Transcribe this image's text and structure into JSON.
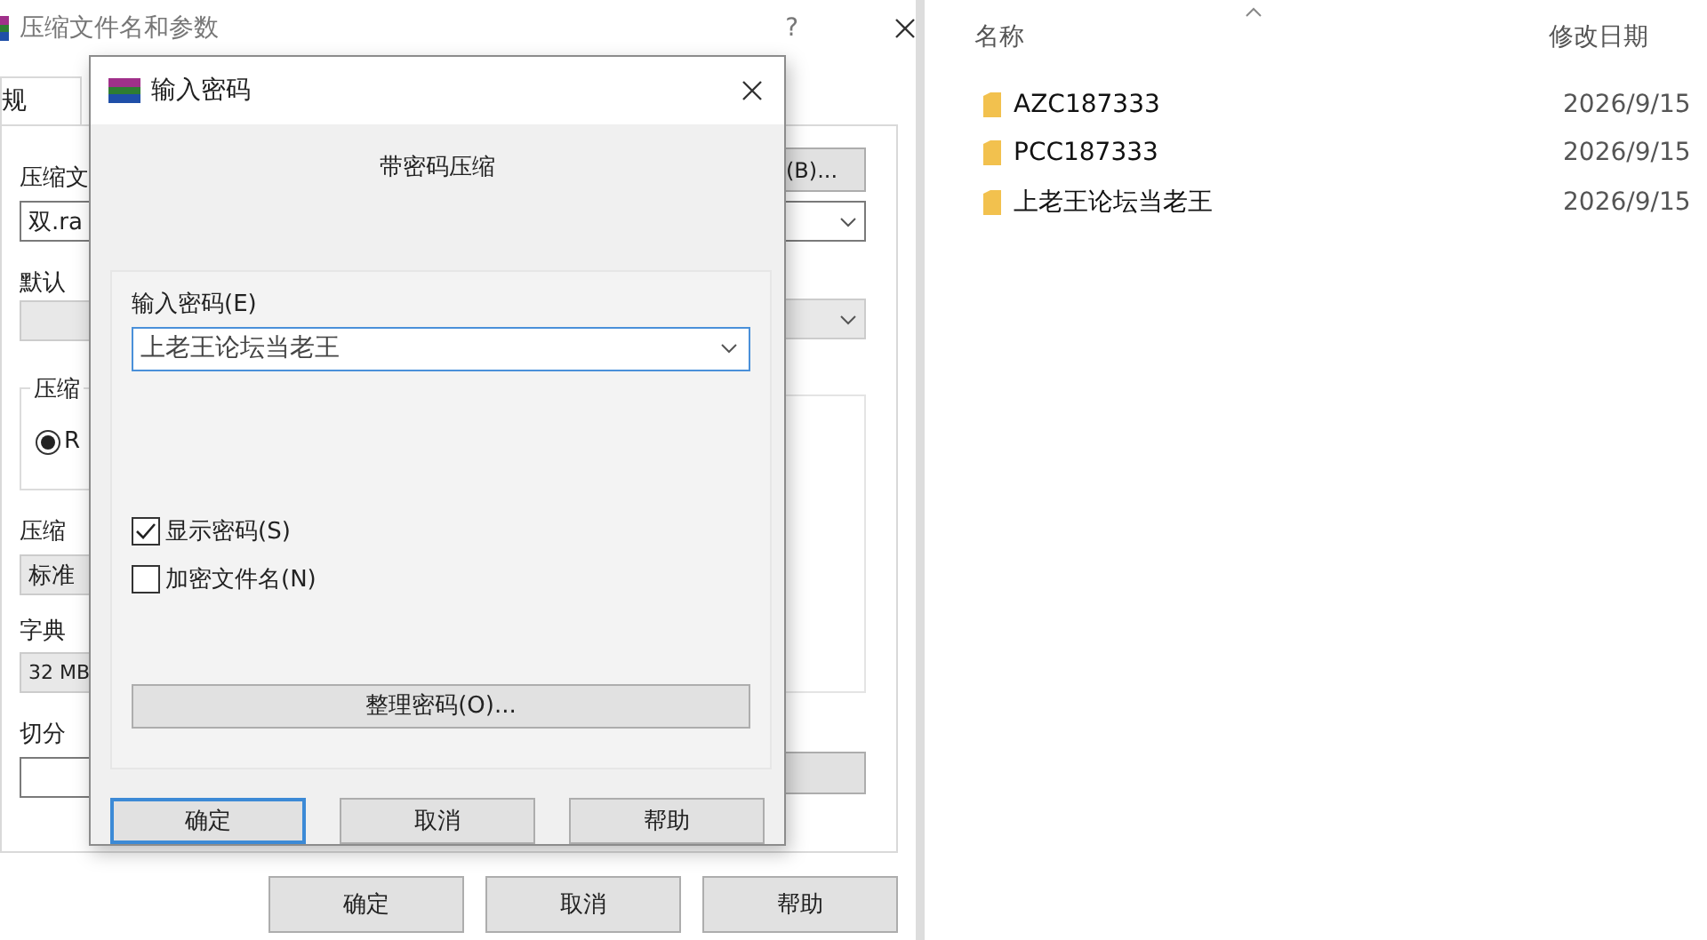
{
  "background_dialog": {
    "title": "压缩文件名和参数",
    "help": "?",
    "tab": {
      "label": "规",
      "selected": true
    },
    "archive_name_label": "压缩文",
    "archive_name_value": "双.ra",
    "browse_button": "(B)...",
    "profile_label": "默认",
    "format_group_label": "压缩",
    "format_radio": {
      "label": "R",
      "selected": true
    },
    "method_label": "压缩",
    "method_value": "标准",
    "dictionary_label": "字典",
    "dictionary_value": "32 MB",
    "split_label": "切分",
    "buttons": [
      "确定",
      "取消",
      "帮助"
    ]
  },
  "password_dialog": {
    "title": "输入密码",
    "heading": "带密码压缩",
    "password_label": "输入密码(E)",
    "password_value": "上老王论坛当老王",
    "options": [
      {
        "label": "显示密码(S)",
        "checked": true
      },
      {
        "label": "加密文件名(N)",
        "checked": false
      }
    ],
    "organize_button": "整理密码(O)...",
    "buttons": [
      {
        "label": "确定",
        "default": true
      },
      {
        "label": "取消",
        "default": false
      },
      {
        "label": "帮助",
        "default": false
      }
    ]
  },
  "file_list": {
    "columns": [
      "名称",
      "修改日期"
    ],
    "rows": [
      {
        "name": "AZC187333",
        "modified": "2026/9/15"
      },
      {
        "name": "PCC187333",
        "modified": "2026/9/15"
      },
      {
        "name": "上老王论坛当老王",
        "modified": "2026/9/15"
      }
    ]
  }
}
